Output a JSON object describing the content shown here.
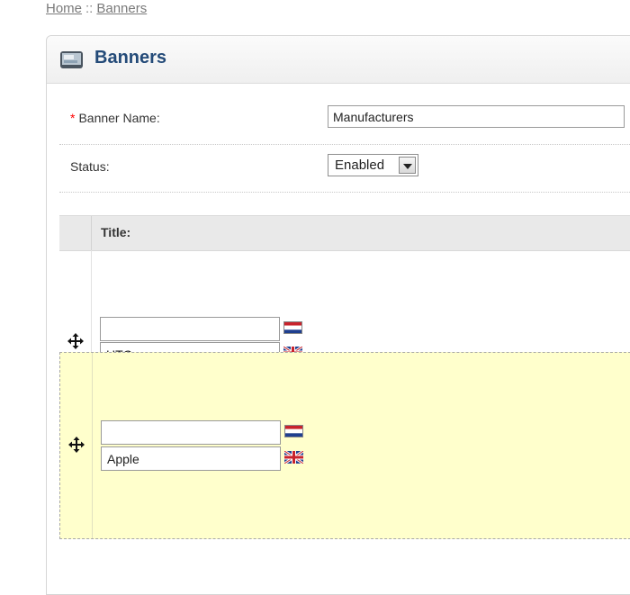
{
  "breadcrumb": {
    "home": "Home",
    "separator": "::",
    "current": "Banners"
  },
  "header": {
    "title": "Banners",
    "icon": "banner-icon"
  },
  "form": {
    "banner_name": {
      "required_mark": "*",
      "label": "Banner Name:",
      "value": "Manufacturers"
    },
    "status": {
      "label": "Status:",
      "value": "Enabled"
    }
  },
  "table": {
    "columns": [
      "Title:"
    ],
    "rows": [
      {
        "title_nl": "",
        "title_en": "HTC",
        "flags": [
          "netherlands-flag-icon",
          "uk-flag-icon"
        ]
      },
      {
        "title_nl": "",
        "title_en": "Apple",
        "flags": [
          "netherlands-flag-icon",
          "uk-flag-icon"
        ],
        "dragging": true
      }
    ]
  },
  "icons": {
    "drag": "move-arrows-icon"
  },
  "colors": {
    "title": "#234a78",
    "drag_highlight": "#ffffcc",
    "required": "#ff0000"
  }
}
